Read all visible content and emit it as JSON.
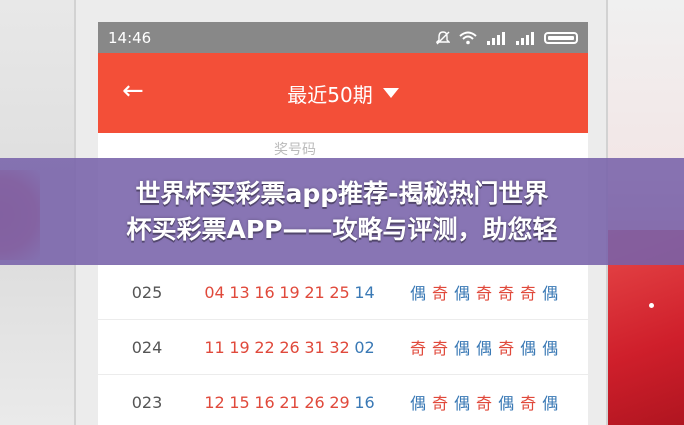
{
  "status_bar": {
    "time": "14:46",
    "icons": [
      "mute-icon",
      "wifi-icon",
      "signal-icon",
      "signal-icon",
      "battery-icon"
    ]
  },
  "app_bar": {
    "back_glyph": "←",
    "title": "最近50期"
  },
  "table": {
    "header": [
      "奖号码"
    ],
    "rows": [
      {
        "issue": "025",
        "numbers": [
          "04",
          "13",
          "16",
          "19",
          "21",
          "25",
          "14"
        ],
        "parity": [
          "偶",
          "奇",
          "偶",
          "奇",
          "奇",
          "奇",
          "偶"
        ]
      },
      {
        "issue": "024",
        "numbers": [
          "11",
          "19",
          "22",
          "26",
          "31",
          "32",
          "02"
        ],
        "parity": [
          "奇",
          "奇",
          "偶",
          "偶",
          "奇",
          "偶",
          "偶"
        ]
      },
      {
        "issue": "023",
        "numbers": [
          "12",
          "15",
          "16",
          "21",
          "26",
          "29",
          "16"
        ],
        "parity": [
          "偶",
          "奇",
          "偶",
          "奇",
          "偶",
          "奇",
          "偶"
        ]
      }
    ]
  },
  "banner": {
    "line1": "世界杯买彩票app推荐-揭秘热门世界",
    "line2": "杯买彩票APP——攻略与评测，助您轻"
  },
  "colors": {
    "app_bar": "#f34f38",
    "red_ball": "#e0493b",
    "blue_ball": "#3a79b5",
    "banner": "#7862aa"
  }
}
